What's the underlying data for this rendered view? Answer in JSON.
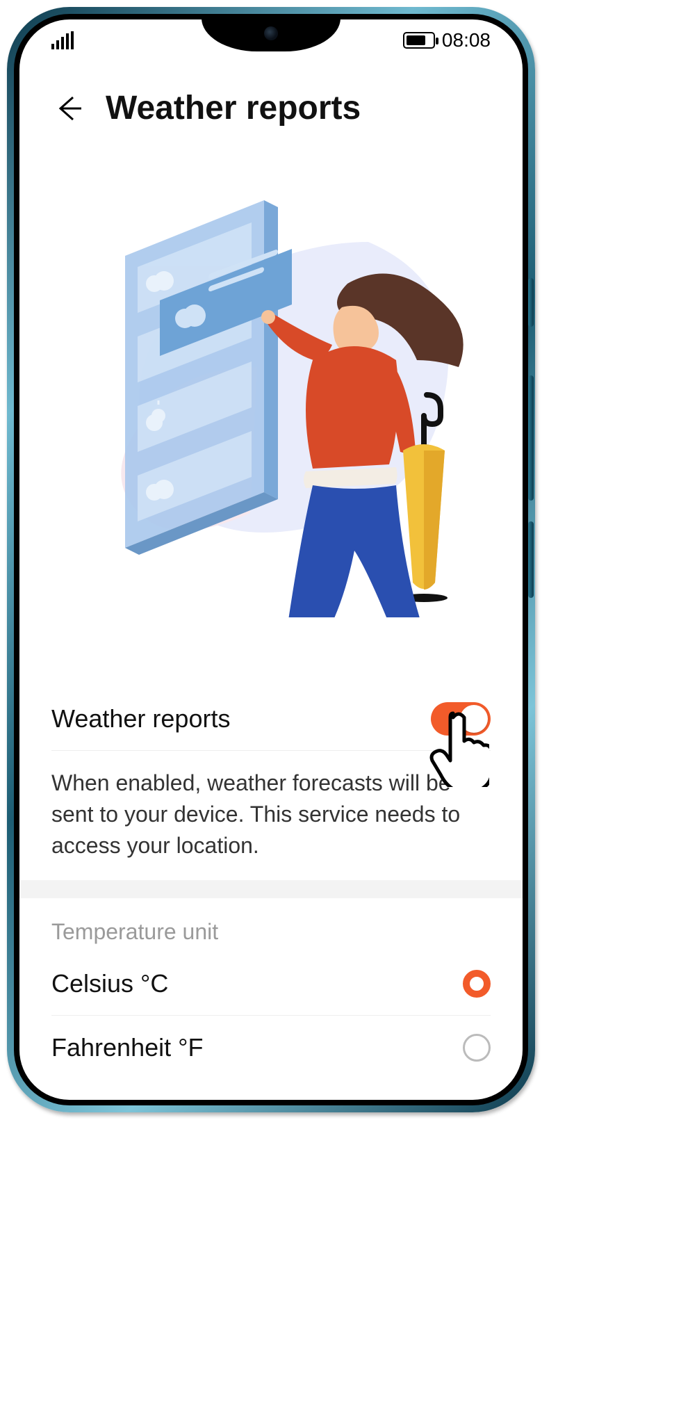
{
  "statusbar": {
    "time": "08:08"
  },
  "header": {
    "title": "Weather reports"
  },
  "settings": {
    "weather_reports": {
      "label": "Weather reports",
      "enabled": true,
      "description": "When enabled, weather forecasts will be sent to your device. This service needs to access your location."
    },
    "temperature_unit": {
      "section_label": "Temperature unit",
      "options": [
        {
          "label": "Celsius °C",
          "value": "celsius",
          "selected": true
        },
        {
          "label": "Fahrenheit °F",
          "value": "fahrenheit",
          "selected": false
        }
      ]
    }
  },
  "colors": {
    "accent": "#f25b2a"
  }
}
